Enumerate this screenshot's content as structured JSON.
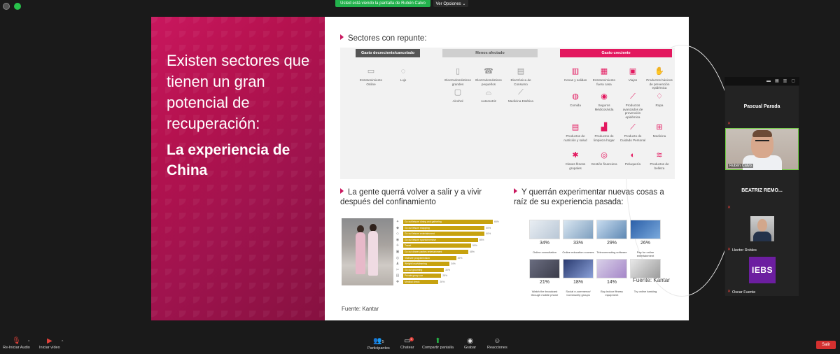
{
  "top": {
    "share_banner": "Usted está viendo la pantalla de Rubén Calvo",
    "view_options": "Ver Opciones ⌄"
  },
  "slide": {
    "left_title": "Existen sectores que tienen un gran potencial de recuperación:",
    "left_subtitle": "La experiencia de China",
    "section1_title": "Sectores con repunte:",
    "col1_header": "Gasto decreciente/cancelado",
    "col2_header": "Menos afectado",
    "col3_header": "Gasto creciente",
    "col1_items": [
      "Entretenimiento Online",
      "Lujo"
    ],
    "col2_items": [
      "Electrodomésticos grandes",
      "Electrodomésticos pequeños",
      "Electrónica de Consumo",
      "Alcohol",
      "Automotriz",
      "Medicina Estética"
    ],
    "col3_items": [
      "Cenas y salidas",
      "Entretenimiento fuera casa",
      "Viajes",
      "Productos básicos de prevención epidémica",
      "Comida",
      "Seguros Médicos/vida",
      "Productos avanzados de prevención epidémica",
      "Ropa",
      "Productos de nutrición y salud",
      "Productos de limpieza hogar",
      "Producto de Cuidado Personal",
      "Medicina",
      "Clases fitness grupales",
      "Gestión financiera",
      "Peluquería",
      "Productos de belleza"
    ],
    "section2_title": "La gente querrá volver a salir y a vivir después del confinamiento",
    "section3_title": "Y querrán experimentar nuevas cosas a raíz de su experiencia pasada:",
    "bars": [
      {
        "label": "Go out/leisure dining and gathering",
        "pct": "66%",
        "value": 66
      },
      {
        "label": "Go out leisure shopping",
        "pct": "60%",
        "value": 60
      },
      {
        "label": "Go out leisure entertainment",
        "pct": "60%",
        "value": 60
      },
      {
        "label": "Go out leisure sports/exercise",
        "pct": "55%",
        "value": 55
      },
      {
        "label": "Travel",
        "pct": "50%",
        "value": 50
      },
      {
        "label": "Go out dinner parties entertainment",
        "pct": "48%",
        "value": 48
      },
      {
        "label": "Visit/see program/vision",
        "pct": "39%",
        "value": 39
      },
      {
        "label": "Weight loss/slimming",
        "pct": "34%",
        "value": 34
      },
      {
        "label": "Go out grooming",
        "pct": "30%",
        "value": 30
      },
      {
        "label": "Private group car",
        "pct": "28%",
        "value": 28
      },
      {
        "label": "Medical check",
        "pct": "26%",
        "value": 26
      }
    ],
    "tiles": [
      {
        "pct": "34%",
        "label": "Online consultation"
      },
      {
        "pct": "33%",
        "label": "Online education courses"
      },
      {
        "pct": "29%",
        "label": "Telecommuting software"
      },
      {
        "pct": "26%",
        "label": "Pay for online entertainment"
      },
      {
        "pct": "21%",
        "label": "Watch the broadcast through mobile phone"
      },
      {
        "pct": "18%",
        "label": "Social e-commerce/ Community groups"
      },
      {
        "pct": "14%",
        "label": "Buy indoor fitness equipment"
      },
      {
        "pct": "",
        "label": "Try online banking"
      }
    ],
    "fuente_right": "Fuente: Kantar",
    "fuente_bottom": "Fuente: Kantar"
  },
  "panel": {
    "p1": "Pascual Parada",
    "p2": "Rubén Calvo",
    "p3": "BEATRIZ REMO...",
    "p4": "Hector Robles",
    "p5": "Oscar Fuente",
    "iebs": "IEBS"
  },
  "toolbar": {
    "audio": "Re-Iniciar Audio",
    "video": "Iniciar vídeo",
    "participants": "Participantes",
    "participants_count": "5",
    "chat": "Chatear",
    "chat_badge": "1",
    "share": "Compartir pantalla",
    "record": "Grabar",
    "reactions": "Reacciones",
    "leave": "Salir"
  },
  "colors": {
    "brand_pink": "#e3185f",
    "bar_gold": "#c7a20f",
    "zoom_green": "#22b14c",
    "leave_red": "#d4302f"
  }
}
